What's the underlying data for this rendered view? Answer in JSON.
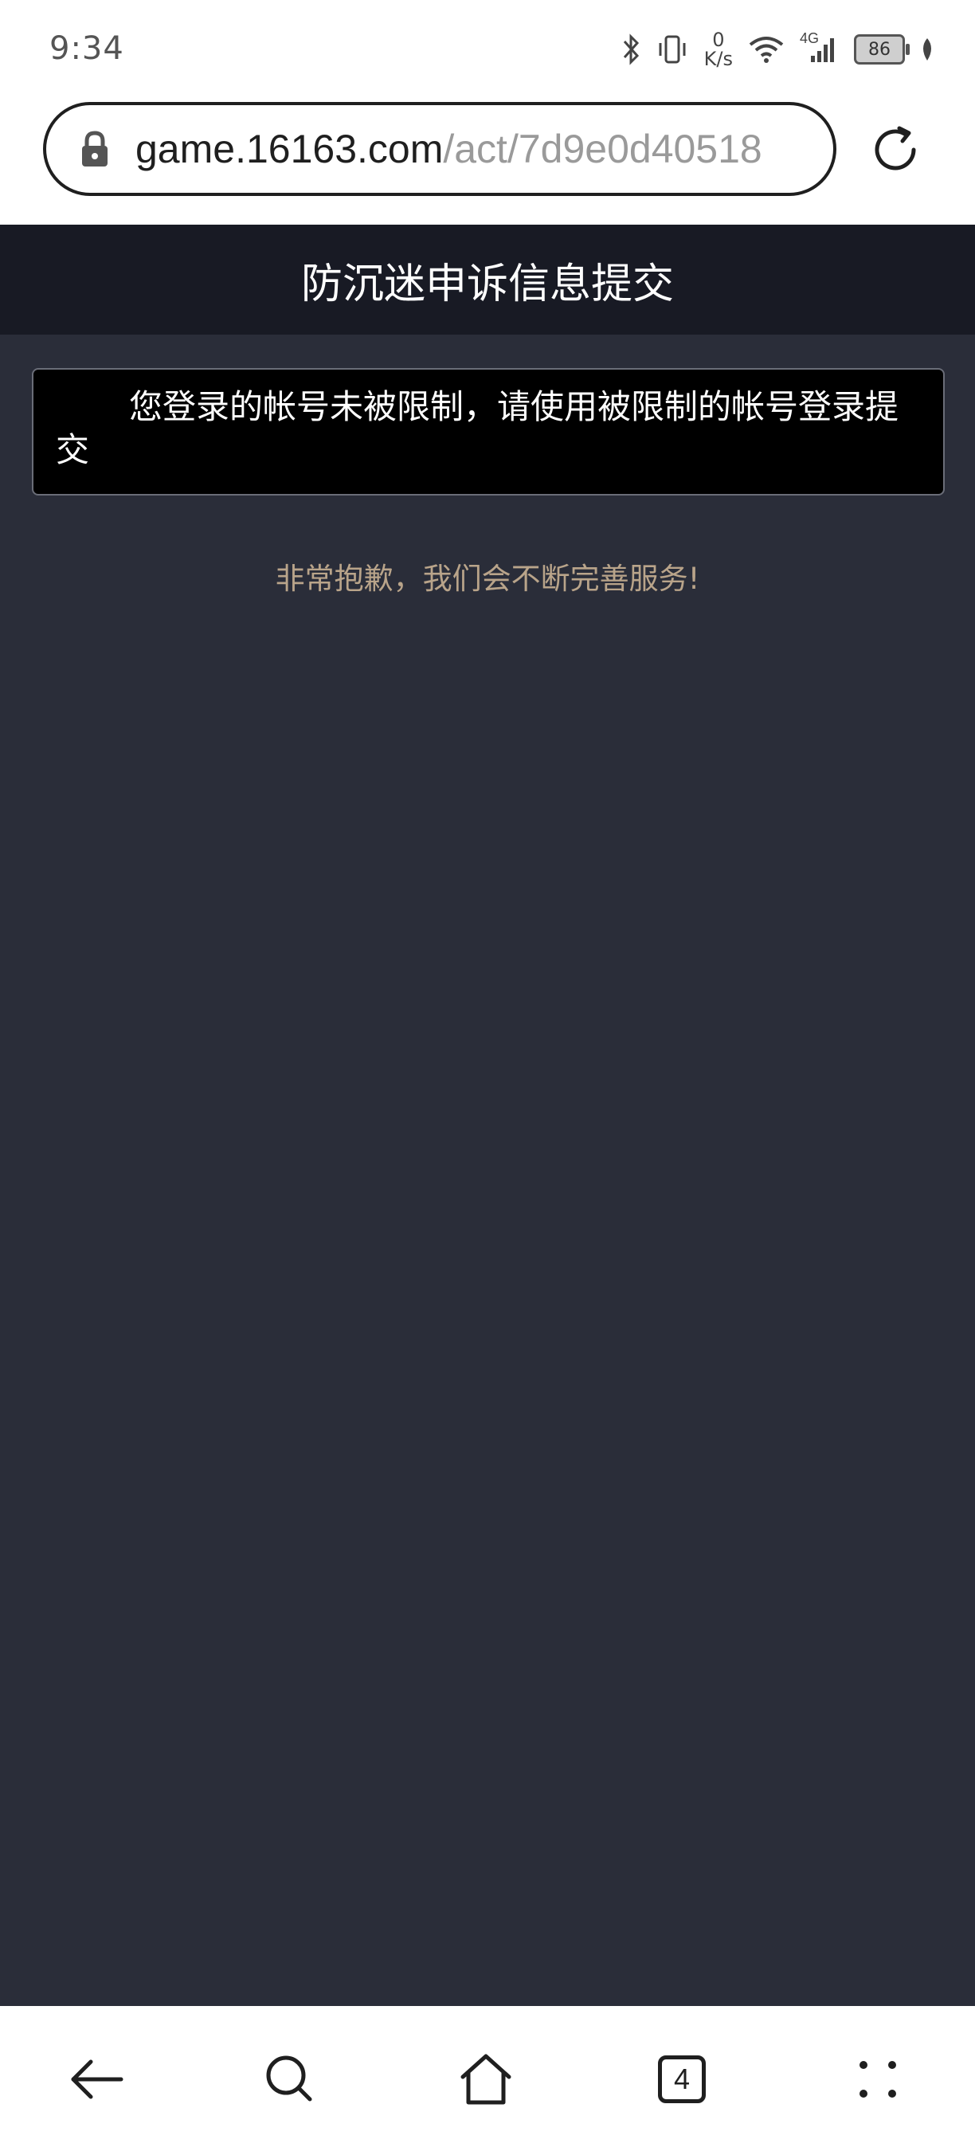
{
  "status_bar": {
    "time": "9:34",
    "network_speed_value": "0",
    "network_speed_unit": "K/s",
    "network_type": "4G",
    "battery": "86"
  },
  "browser": {
    "url_host": "game.16163.com",
    "url_path": "/act/7d9e0d40518",
    "tab_count": "4"
  },
  "page": {
    "title": "防沉迷申诉信息提交",
    "message": "您登录的帐号未被限制，请使用被限制的帐号登录提交",
    "apology": "非常抱歉，我们会不断完善服务!"
  },
  "colors": {
    "page_background": "#2a2d39",
    "header_background": "#181a24",
    "message_background": "#000000",
    "apology_text": "#b9a48a"
  },
  "icons": {
    "address_bar": [
      "lock-icon",
      "reload-icon"
    ],
    "bottom_nav": [
      "back-arrow-icon",
      "search-icon",
      "home-icon",
      "tabs-icon",
      "more-dots-icon"
    ],
    "status_bar": [
      "bluetooth-icon",
      "vibrate-icon",
      "wifi-icon",
      "signal-icon",
      "battery-icon",
      "leaf-icon"
    ]
  }
}
